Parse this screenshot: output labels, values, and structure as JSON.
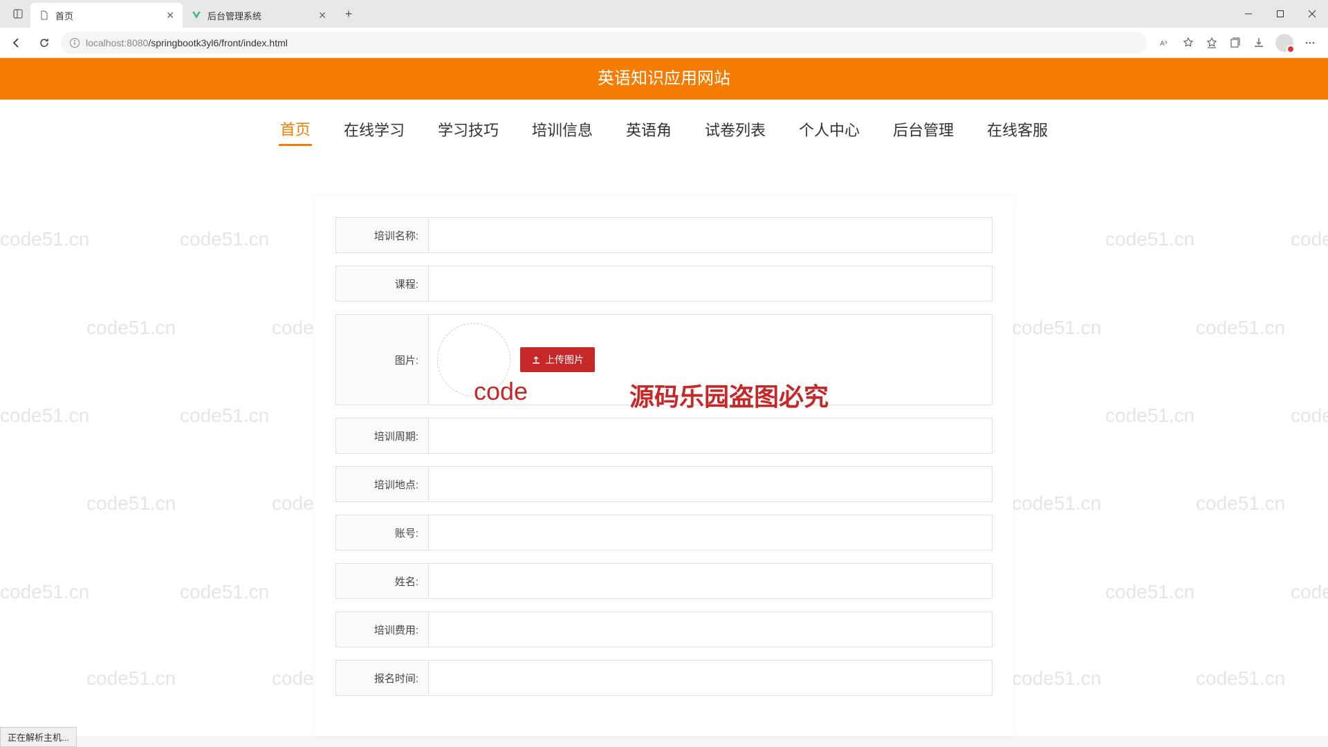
{
  "browser": {
    "tabs": [
      {
        "title": "首页",
        "active": true
      },
      {
        "title": "后台管理系统",
        "active": false
      }
    ],
    "url_host": "localhost",
    "url_port": ":8080",
    "url_path": "/springbootk3yl6/front/index.html"
  },
  "site": {
    "title": "英语知识应用网站"
  },
  "nav": {
    "items": [
      {
        "label": "首页",
        "active": true
      },
      {
        "label": "在线学习",
        "active": false
      },
      {
        "label": "学习技巧",
        "active": false
      },
      {
        "label": "培训信息",
        "active": false
      },
      {
        "label": "英语角",
        "active": false
      },
      {
        "label": "试卷列表",
        "active": false
      },
      {
        "label": "个人中心",
        "active": false
      },
      {
        "label": "后台管理",
        "active": false
      },
      {
        "label": "在线客服",
        "active": false
      }
    ]
  },
  "form": {
    "fields": [
      {
        "label": "培训名称:",
        "type": "text"
      },
      {
        "label": "课程:",
        "type": "text"
      },
      {
        "label": "图片:",
        "type": "upload"
      },
      {
        "label": "培训周期:",
        "type": "text"
      },
      {
        "label": "培训地点:",
        "type": "text"
      },
      {
        "label": "账号:",
        "type": "text"
      },
      {
        "label": "姓名:",
        "type": "text"
      },
      {
        "label": "培训费用:",
        "type": "text"
      },
      {
        "label": "报名时间:",
        "type": "text"
      }
    ],
    "uploadBtn": "上传图片"
  },
  "overlay": {
    "code_prefix": "code",
    "big_text": "源码乐园盗图必究"
  },
  "status": {
    "text": "正在解析主机..."
  },
  "watermark": {
    "text": "code51.cn"
  }
}
